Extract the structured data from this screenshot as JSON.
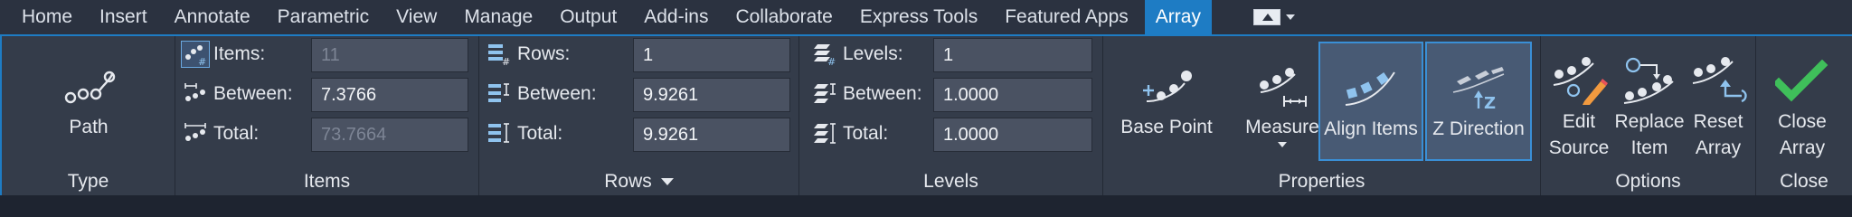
{
  "tabs": [
    {
      "label": "Home"
    },
    {
      "label": "Insert"
    },
    {
      "label": "Annotate"
    },
    {
      "label": "Parametric"
    },
    {
      "label": "View"
    },
    {
      "label": "Manage"
    },
    {
      "label": "Output"
    },
    {
      "label": "Add-ins"
    },
    {
      "label": "Collaborate"
    },
    {
      "label": "Express Tools"
    },
    {
      "label": "Featured Apps"
    },
    {
      "label": "Array"
    }
  ],
  "active_tab": "Array",
  "panels": {
    "type": {
      "title": "Type",
      "path_label": "Path"
    },
    "items": {
      "title": "Items",
      "items_label": "Items:",
      "items_value": "11",
      "between_label": "Between:",
      "between_value": "7.3766",
      "total_label": "Total:",
      "total_value": "73.7664"
    },
    "rows": {
      "title": "Rows",
      "rows_label": "Rows:",
      "rows_value": "1",
      "between_label": "Between:",
      "between_value": "9.9261",
      "total_label": "Total:",
      "total_value": "9.9261"
    },
    "levels": {
      "title": "Levels",
      "levels_label": "Levels:",
      "levels_value": "1",
      "between_label": "Between:",
      "between_value": "1.0000",
      "total_label": "Total:",
      "total_value": "1.0000"
    },
    "properties": {
      "title": "Properties",
      "base_point": "Base Point",
      "measure": "Measure",
      "align_items": "Align Items",
      "z_direction": "Z Direction"
    },
    "options": {
      "title": "Options",
      "edit_source_1": "Edit",
      "edit_source_2": "Source",
      "replace_item_1": "Replace",
      "replace_item_2": "Item",
      "reset_array_1": "Reset",
      "reset_array_2": "Array"
    },
    "close": {
      "title": "Close",
      "close_array_1": "Close",
      "close_array_2": "Array"
    }
  },
  "colors": {
    "accent": "#1e7cc4",
    "check_green": "#3fbf5a",
    "icon_blue": "#8fc3ee"
  }
}
